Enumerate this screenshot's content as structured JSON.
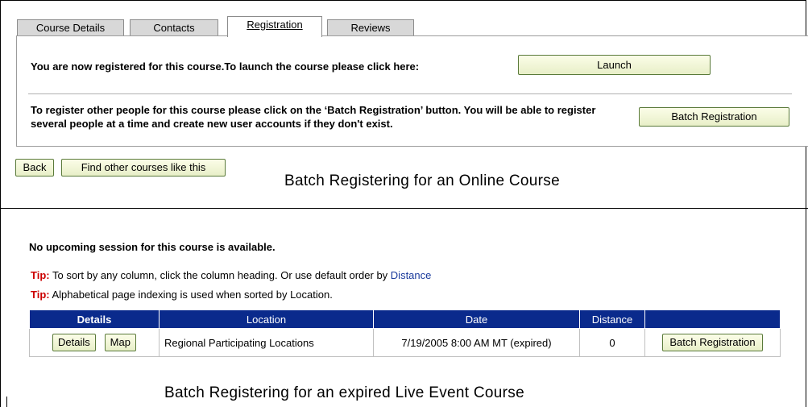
{
  "tabs": [
    {
      "label": "Course Details",
      "active": false
    },
    {
      "label": "Contacts",
      "active": false
    },
    {
      "label": "Registration",
      "active": true
    },
    {
      "label": "Reviews",
      "active": false
    }
  ],
  "registration": {
    "registered_text": "You are now registered for this course.To launch the course please click here:",
    "launch_label": "Launch",
    "batch_text": "To register other people for this course please click on the ‘Batch Registration’ button. You will be able to register several people at a time and create new user accounts if they don't exist.",
    "batch_label": "Batch Registration"
  },
  "nav": {
    "back_label": "Back",
    "find_label": "Find other courses like this"
  },
  "captions": {
    "top": "Batch Registering for an Online Course",
    "bottom": "Batch Registering for an expired Live Event Course"
  },
  "sessions": {
    "no_session_text": "No upcoming session for this course is available.",
    "tip_label": "Tip:",
    "tip1_text": " To sort by any column, click the column heading. Or use default order by ",
    "tip1_link": "Distance",
    "tip2_text": " Alphabetical page indexing is used when sorted by Location.",
    "headers": [
      "Details",
      "Location",
      "Date",
      "Distance",
      ""
    ],
    "row": {
      "details_label": "Details",
      "map_label": "Map",
      "location": "Regional Participating Locations",
      "date": "7/19/2005 8:00 AM MT (expired)",
      "distance": "0",
      "batch_label": "Batch Registration"
    }
  },
  "colors": {
    "header_bg": "#0a2a8c",
    "tip_red": "#cc0000",
    "link_blue": "#1a3a9c",
    "button_border": "#5a7a3a"
  }
}
